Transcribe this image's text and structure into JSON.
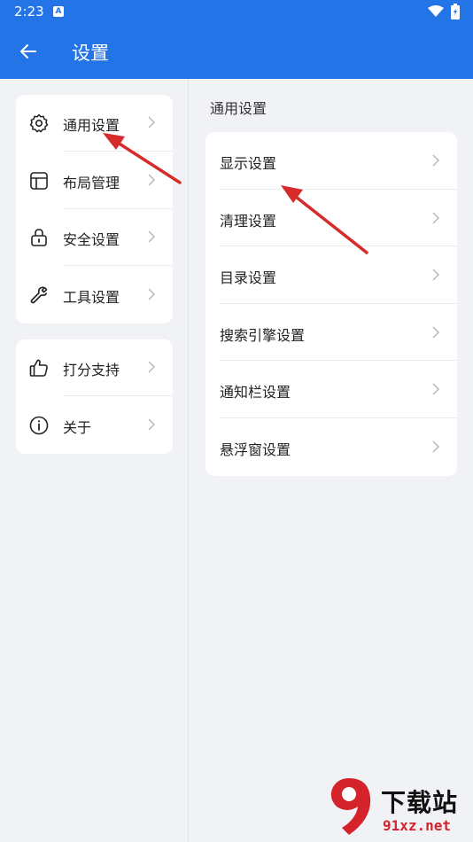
{
  "status_bar": {
    "time": "2:23",
    "app_badge": "A"
  },
  "app_bar": {
    "title": "设置"
  },
  "left_menu": {
    "main": [
      {
        "label": "通用设置",
        "icon": "gear-icon"
      },
      {
        "label": "布局管理",
        "icon": "layout-icon"
      },
      {
        "label": "安全设置",
        "icon": "lock-icon"
      },
      {
        "label": "工具设置",
        "icon": "wrench-icon"
      }
    ],
    "misc": [
      {
        "label": "打分支持",
        "icon": "thumbs-up-icon"
      },
      {
        "label": "关于",
        "icon": "info-icon"
      }
    ]
  },
  "general": {
    "section_title": "通用设置",
    "items": [
      {
        "label": "显示设置"
      },
      {
        "label": "清理设置"
      },
      {
        "label": "目录设置"
      },
      {
        "label": "搜索引擎设置"
      },
      {
        "label": "通知栏设置"
      },
      {
        "label": "悬浮窗设置"
      }
    ]
  },
  "watermark": {
    "brand": "下载站",
    "url": "91xz.net"
  },
  "colors": {
    "accent": "#2374e6",
    "background": "#f1f2f6",
    "annotation": "#d62b2b"
  }
}
